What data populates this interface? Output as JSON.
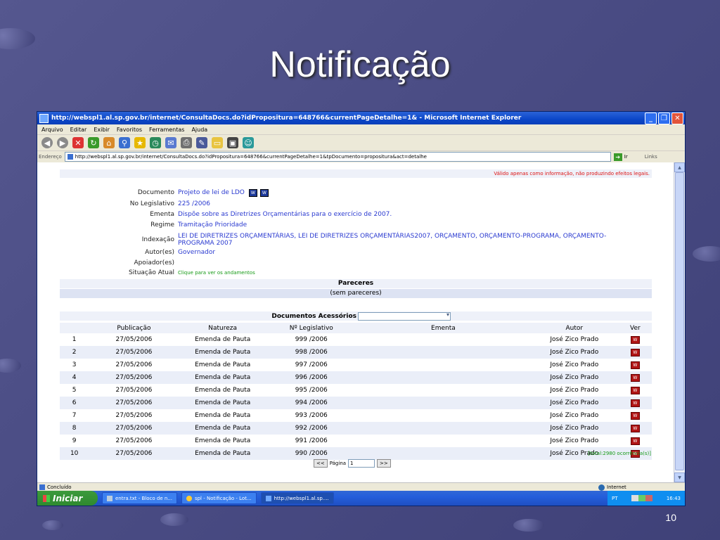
{
  "slide": {
    "title": "Notificação",
    "number": "10"
  },
  "window": {
    "title": "http://webspl1.al.sp.gov.br/internet/ConsultaDocs.do?idPropositura=648766&currentPageDetalhe=1& - Microsoft Internet Explorer"
  },
  "menu": [
    "Arquivo",
    "Editar",
    "Exibir",
    "Favoritos",
    "Ferramentas",
    "Ajuda"
  ],
  "address": {
    "label": "Endereço",
    "url": "http://webspl1.al.sp.gov.br/internet/ConsultaDocs.do?idPropositura=648766&currentPageDetalhe=1&tpDocumento=propositura&act=detalhe",
    "go": "Ir",
    "links": "Links"
  },
  "page": {
    "notice": "Válido apenas como informação, não produzindo efeitos legais.",
    "fields": {
      "documento": {
        "label": "Documento",
        "value": "Projeto de lei de LDO"
      },
      "no_legislativo": {
        "label": "No Legislativo",
        "value": "225 /2006"
      },
      "ementa": {
        "label": "Ementa",
        "value": "Dispõe sobre as Diretrizes Orçamentárias para o exercício de 2007."
      },
      "regime": {
        "label": "Regime",
        "value": "Tramitação Prioridade"
      },
      "indexacao": {
        "label": "Indexação",
        "value": "LEI DE DIRETRIZES ORÇAMENTÁRIAS, LEI DE DIRETRIZES ORÇAMENTÁRIAS2007, ORÇAMENTO, ORÇAMENTO-PROGRAMA, ORÇAMENTO-PROGRAMA 2007"
      },
      "autores": {
        "label": "Autor(es)",
        "value": "Governador"
      },
      "apoiadores": {
        "label": "Apoiador(es)",
        "value": ""
      },
      "situacao": {
        "label": "Situação Atual",
        "value": "Clique para ver os andamentos"
      }
    },
    "pareceres": {
      "title": "Pareceres",
      "empty": "(sem pareceres)"
    },
    "docs": {
      "title": "Documentos Acessórios",
      "columns": [
        "",
        "Publicação",
        "Natureza",
        "Nº Legislativo",
        "Ementa",
        "Autor",
        "Ver"
      ],
      "rows": [
        {
          "n": "1",
          "pub": "27/05/2006",
          "nat": "Emenda de Pauta",
          "leg": "999 /2006",
          "ementa": "",
          "autor": "José Zico Prado"
        },
        {
          "n": "2",
          "pub": "27/05/2006",
          "nat": "Emenda de Pauta",
          "leg": "998 /2006",
          "ementa": "",
          "autor": "José Zico Prado"
        },
        {
          "n": "3",
          "pub": "27/05/2006",
          "nat": "Emenda de Pauta",
          "leg": "997 /2006",
          "ementa": "",
          "autor": "José Zico Prado"
        },
        {
          "n": "4",
          "pub": "27/05/2006",
          "nat": "Emenda de Pauta",
          "leg": "996 /2006",
          "ementa": "",
          "autor": "José Zico Prado"
        },
        {
          "n": "5",
          "pub": "27/05/2006",
          "nat": "Emenda de Pauta",
          "leg": "995 /2006",
          "ementa": "",
          "autor": "José Zico Prado"
        },
        {
          "n": "6",
          "pub": "27/05/2006",
          "nat": "Emenda de Pauta",
          "leg": "994 /2006",
          "ementa": "",
          "autor": "José Zico Prado"
        },
        {
          "n": "7",
          "pub": "27/05/2006",
          "nat": "Emenda de Pauta",
          "leg": "993 /2006",
          "ementa": "",
          "autor": "José Zico Prado"
        },
        {
          "n": "8",
          "pub": "27/05/2006",
          "nat": "Emenda de Pauta",
          "leg": "992 /2006",
          "ementa": "",
          "autor": "José Zico Prado"
        },
        {
          "n": "9",
          "pub": "27/05/2006",
          "nat": "Emenda de Pauta",
          "leg": "991 /2006",
          "ementa": "",
          "autor": "José Zico Prado"
        },
        {
          "n": "10",
          "pub": "27/05/2006",
          "nat": "Emenda de Pauta",
          "leg": "990 /2006",
          "ementa": "",
          "autor": "José Zico Prado"
        }
      ],
      "total": "[total:2980 ocorrência(s)]",
      "pager": {
        "prev": "<<",
        "label": "Página",
        "page": "1",
        "next": ">>"
      }
    }
  },
  "status": {
    "left": "Concluído",
    "zone": "Internet"
  },
  "taskbar": {
    "start": "Iniciar",
    "tasks": [
      "entra.txt - Bloco de n...",
      "spl - Notificação - Lot...",
      "http://webspl1.al.sp...."
    ],
    "lang": "PT",
    "clock": "16:43"
  },
  "icons": {
    "word": "W",
    "pdf": "W"
  }
}
